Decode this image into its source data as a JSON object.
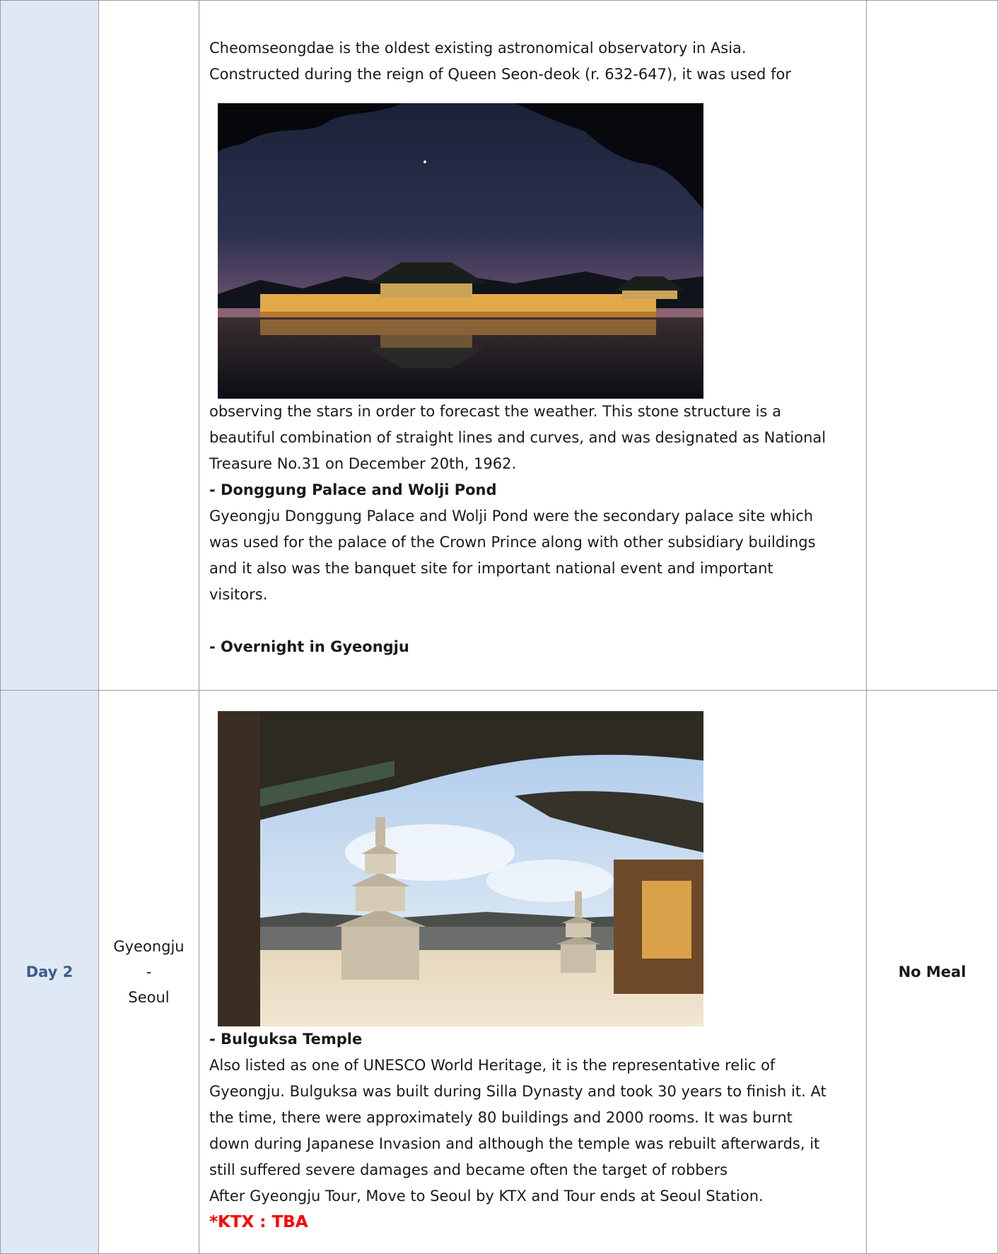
{
  "row1": {
    "day": "",
    "city": "",
    "meal": "",
    "lines_before_photo": [
      "  Cheomseongdae is the oldest existing astronomical observatory in Asia.",
      "Constructed during the reign of Queen Seon-deok (r. 632-647), it was used for"
    ],
    "photo_alt": "Donggung Palace and Wolji Pond at night",
    "lines_after_photo": [
      "observing the stars in order to forecast the weather. This stone structure is a",
      "beautiful combination of straight lines and curves, and was designated as National",
      "Treasure No.31 on December 20th, 1962."
    ],
    "donggung_heading": "- Donggung Palace and Wolji Pond",
    "donggung_lines": [
      "  Gyeongju Donggung Palace and Wolji Pond were the secondary palace site which",
      "was used for the palace of the Crown Prince along with other subsidiary buildings",
      "and it also was the banquet site for important national event and important",
      "visitors."
    ],
    "overnight": "- Overnight in Gyeongju"
  },
  "row2": {
    "day": "Day 2",
    "city_from": "Gyeongju",
    "city_sep": "-",
    "city_to": "Seoul",
    "meal": "No Meal",
    "photo_alt": "Bulguksa Temple pagodas framed by temple eaves",
    "bulguksa_heading": "- Bulguksa Temple",
    "bulguksa_lines": [
      "  Also listed as one of UNESCO World Heritage, it is the representative relic of",
      "Gyeongju. Bulguksa was built during Silla Dynasty and took 30 years to finish it. At",
      "the time, there were approximately 80 buildings and 2000 rooms. It was burnt",
      "down during Japanese Invasion and although the temple was rebuilt afterwards, it",
      "still suffered severe damages and became often the target of robbers",
      "After Gyeongju Tour, Move to Seoul by KTX and Tour ends at Seoul Station."
    ],
    "ktx_note": "*KTX : TBA"
  },
  "colors": {
    "day_cell_bg": "#dfe9f6",
    "day_text": "#3b5d8a",
    "border": "#9a9a9a",
    "highlight": "#ff0000"
  }
}
